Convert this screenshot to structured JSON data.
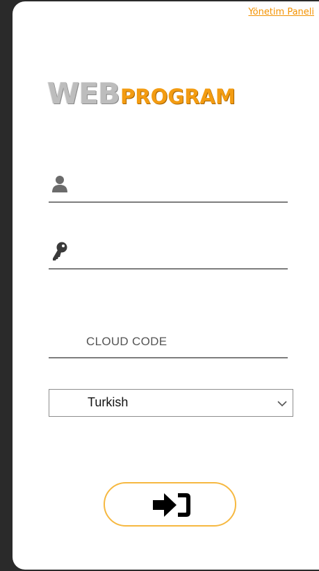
{
  "header": {
    "admin_link_label": "Yönetim Paneli"
  },
  "logo": {
    "part1": "WEB",
    "part2": "PROGRAM",
    "part1_color": "#bdbdbd",
    "part2_color": "#f39c12"
  },
  "form": {
    "username": {
      "icon": "user-icon",
      "value": "",
      "placeholder": ""
    },
    "password": {
      "icon": "key-icon",
      "value": "",
      "placeholder": ""
    },
    "cloud_code": {
      "value": "",
      "placeholder": "CLOUD CODE"
    },
    "language": {
      "selected": "Turkish"
    },
    "login_button": {
      "icon": "sign-in-icon"
    }
  },
  "colors": {
    "accent": "#f39200",
    "button_border": "#f6b840",
    "background": "#2a2a2a",
    "panel": "#ffffff"
  }
}
